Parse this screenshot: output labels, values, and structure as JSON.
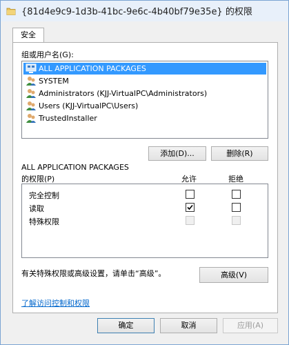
{
  "window": {
    "title": "{81d4e9c9-1d3b-41bc-9e6c-4b40bf79e35e} 的权限"
  },
  "tabs": [
    {
      "label": "安全"
    }
  ],
  "groups": {
    "label": "组或用户名(G):",
    "items": [
      {
        "label": "ALL APPLICATION PACKAGES",
        "icon": "app-packages-icon",
        "selected": true
      },
      {
        "label": "SYSTEM",
        "icon": "users-icon"
      },
      {
        "label": "Administrators (KJJ-VirtualPC\\Administrators)",
        "icon": "users-icon"
      },
      {
        "label": "Users (KJJ-VirtualPC\\Users)",
        "icon": "users-icon"
      },
      {
        "label": "TrustedInstaller",
        "icon": "users-icon"
      }
    ]
  },
  "buttons": {
    "add": "添加(D)...",
    "remove": "删除(R)",
    "advanced": "高级(V)",
    "ok": "确定",
    "cancel": "取消",
    "apply": "应用(A)"
  },
  "permissions": {
    "subject": "ALL APPLICATION PACKAGES",
    "label": "的权限(P)",
    "allow_header": "允许",
    "deny_header": "拒绝",
    "rows": [
      {
        "name": "完全控制",
        "allow": false,
        "deny": false,
        "enabled": true
      },
      {
        "name": "读取",
        "allow": true,
        "deny": false,
        "enabled": true
      },
      {
        "name": "特殊权限",
        "allow": false,
        "deny": false,
        "enabled": false
      }
    ]
  },
  "advanced_hint": "有关特殊权限或高级设置，请单击“高级”。",
  "link": "了解访问控制和权限",
  "colors": {
    "accent": "#3399ff",
    "link": "#0066cc"
  }
}
